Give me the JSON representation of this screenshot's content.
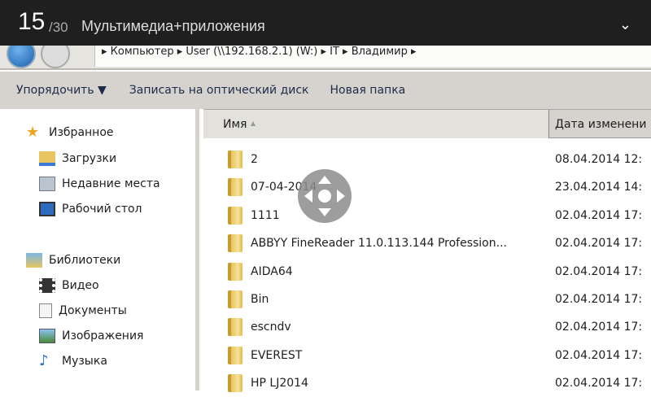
{
  "topbar": {
    "page": "15",
    "total": "/30",
    "title": "Мультимедиа+приложения",
    "chevron": "⌄"
  },
  "address": {
    "path": "▸ Компьютер ▸ User (\\\\192.168.2.1) (W:) ▸ IT ▸ Владимир ▸"
  },
  "toolbar": {
    "organize": "Упорядочить ▼",
    "burn": "Записать на оптический диск",
    "new_folder": "Новая папка"
  },
  "sidebar": {
    "favorites": "Избранное",
    "fav_items": [
      "Загрузки",
      "Недавние места",
      "Рабочий стол"
    ],
    "libraries": "Библиотеки",
    "lib_items": [
      "Видео",
      "Документы",
      "Изображения",
      "Музыка"
    ]
  },
  "columns": {
    "name": "Имя",
    "sort": "▲",
    "date": "Дата изменени"
  },
  "files": [
    {
      "name": "2",
      "date": "08.04.2014 12:"
    },
    {
      "name": "07-04-2014",
      "date": "23.04.2014 14:"
    },
    {
      "name": "1111",
      "date": "02.04.2014 17:"
    },
    {
      "name": "ABBYY FineReader 11.0.113.144 Profession...",
      "date": "02.04.2014 17:"
    },
    {
      "name": "AIDA64",
      "date": "02.04.2014 17:"
    },
    {
      "name": "Bin",
      "date": "02.04.2014 17:"
    },
    {
      "name": "escndv",
      "date": "02.04.2014 17:"
    },
    {
      "name": "EVEREST",
      "date": "02.04.2014 17:"
    },
    {
      "name": "HP LJ2014",
      "date": "02.04.2014 17:"
    }
  ]
}
